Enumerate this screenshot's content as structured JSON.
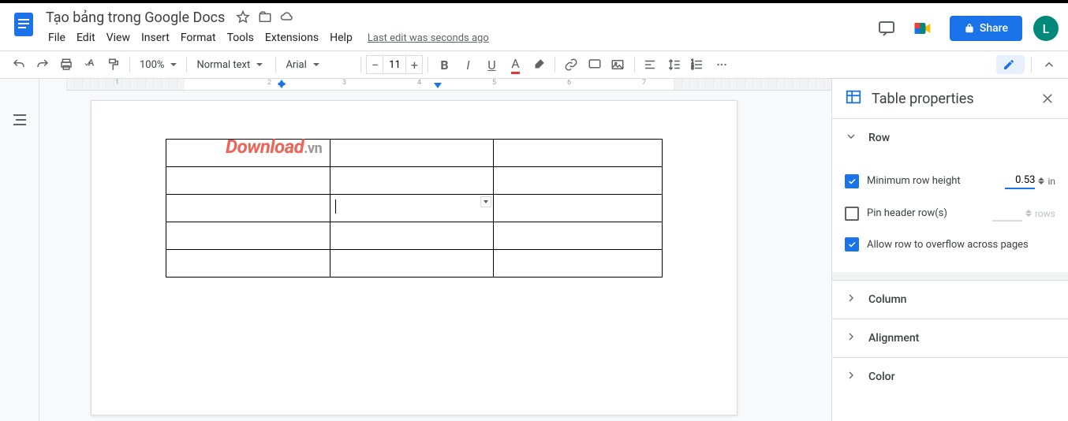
{
  "header": {
    "title": "Tạo bảng trong Google Docs",
    "last_edit": "Last edit was seconds ago",
    "share_label": "Share",
    "avatar_initial": "L"
  },
  "menu": {
    "file": "File",
    "edit": "Edit",
    "view": "View",
    "insert": "Insert",
    "format": "Format",
    "tools": "Tools",
    "extensions": "Extensions",
    "help": "Help"
  },
  "toolbar": {
    "zoom": "100%",
    "style": "Normal text",
    "font": "Arial",
    "font_size": "11",
    "text_color_letter": "A"
  },
  "ruler": {
    "marks": [
      "1",
      "2",
      "3",
      "4",
      "5",
      "6",
      "7"
    ]
  },
  "watermark": {
    "main": "Download",
    "suffix": ".vn"
  },
  "side_panel": {
    "title": "Table properties",
    "sections": {
      "row": "Row",
      "column": "Column",
      "alignment": "Alignment",
      "color": "Color"
    },
    "row_body": {
      "min_height_label": "Minimum row height",
      "min_height_value": "0.53",
      "min_height_unit": "in",
      "pin_header_label": "Pin header row(s)",
      "pin_unit": "rows",
      "overflow_label": "Allow row to overflow across pages"
    }
  }
}
